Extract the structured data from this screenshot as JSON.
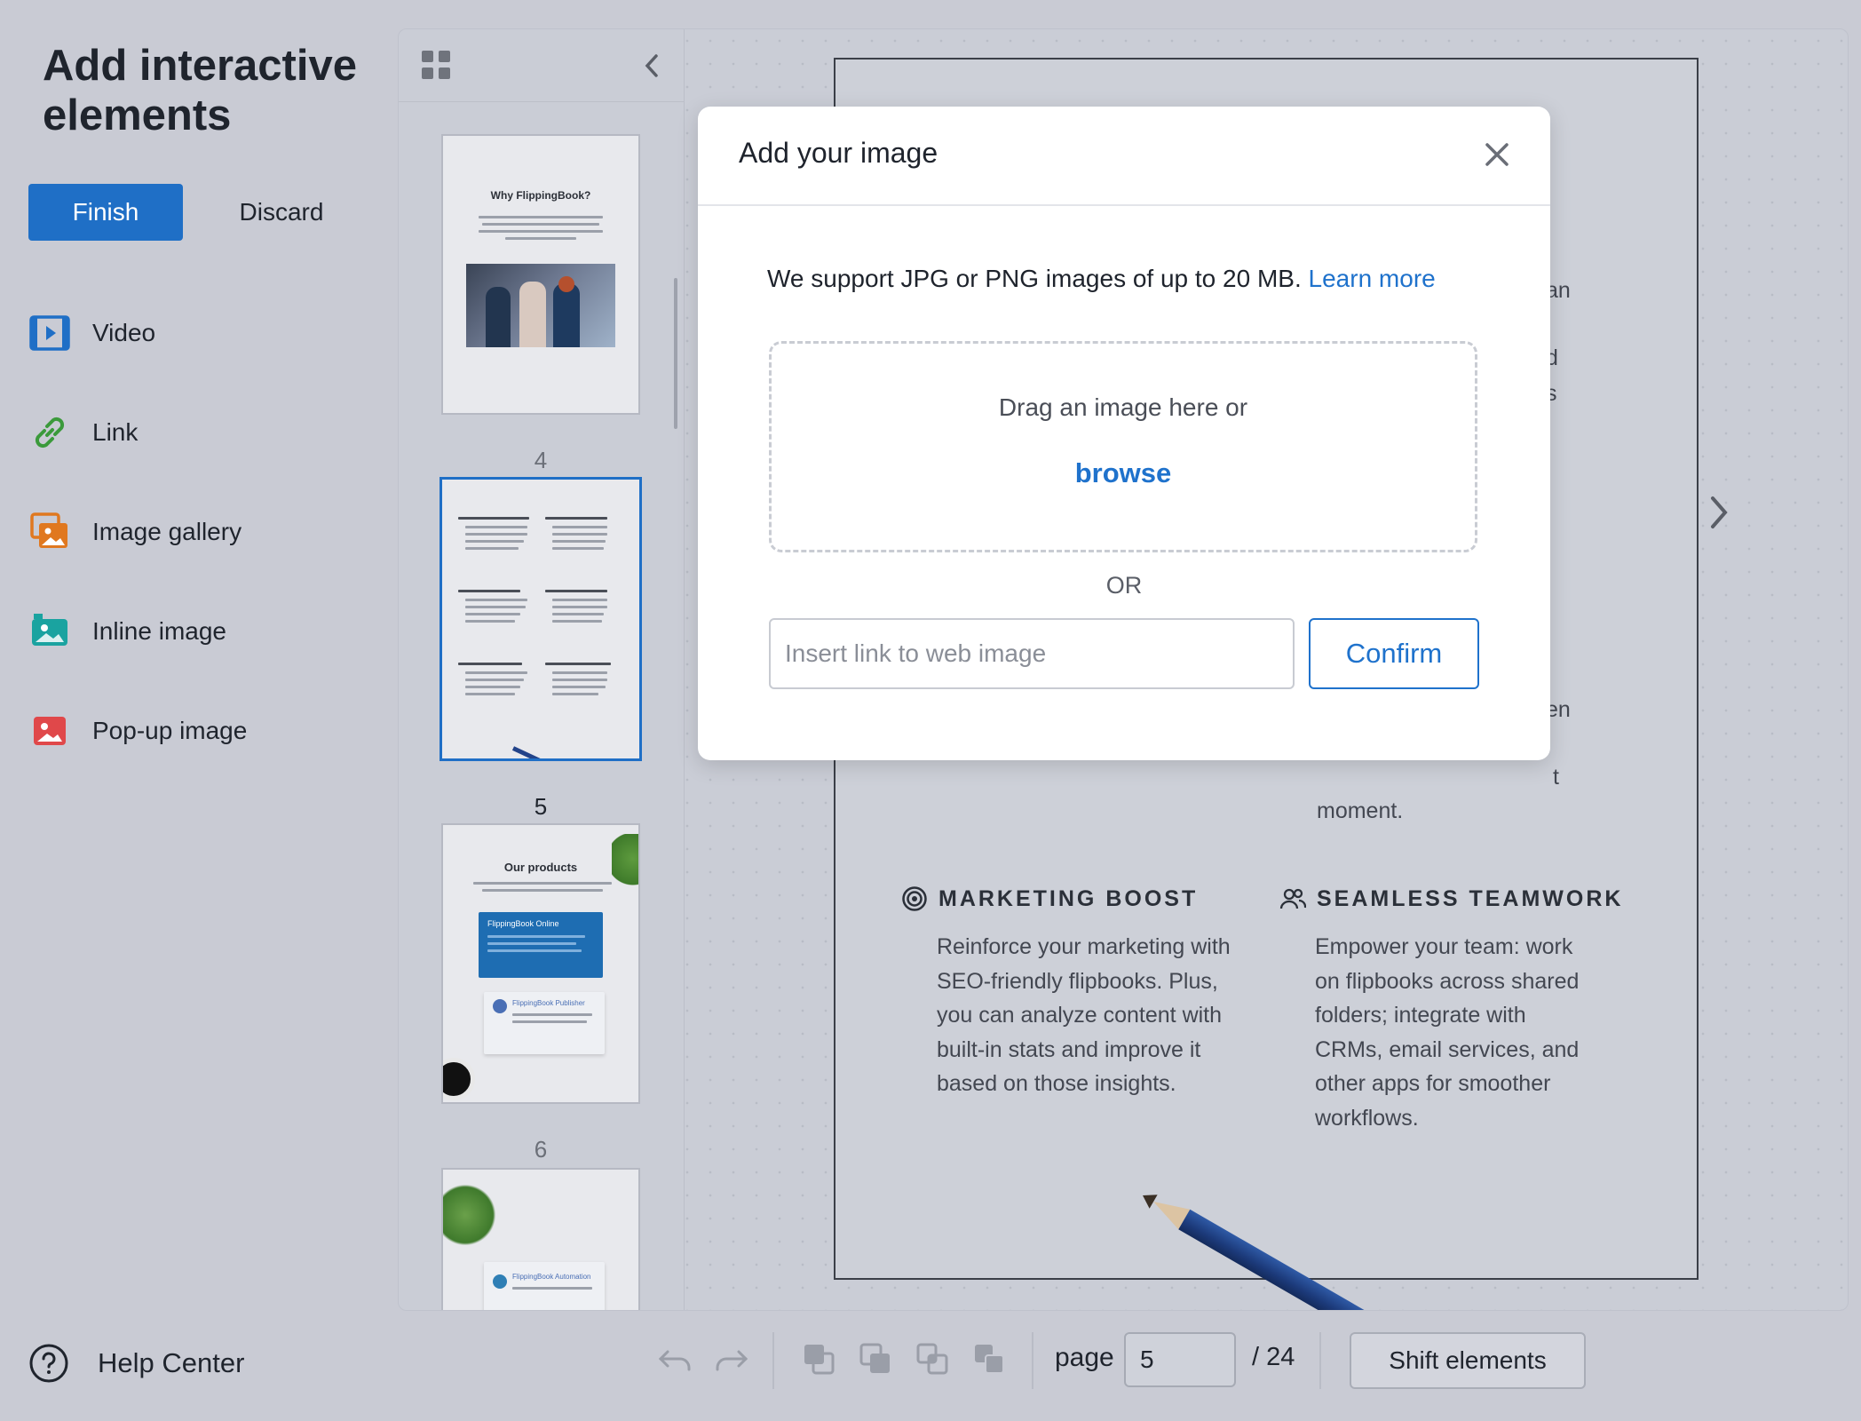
{
  "sidebar": {
    "title": "Add interactive elements",
    "finish_label": "Finish",
    "discard_label": "Discard",
    "items": [
      {
        "label": "Video",
        "icon": "video-icon",
        "color": "#1f6fc6"
      },
      {
        "label": "Link",
        "icon": "link-icon",
        "color": "#3b9a3b"
      },
      {
        "label": "Image gallery",
        "icon": "image-gallery-icon",
        "color": "#e0781f"
      },
      {
        "label": "Inline image",
        "icon": "inline-image-icon",
        "color": "#1aa3a0"
      },
      {
        "label": "Pop-up image",
        "icon": "popup-image-icon",
        "color": "#e0484a"
      }
    ],
    "help_label": "Help Center"
  },
  "thumbnails": [
    {
      "page": "4",
      "title": "Why FlippingBook?"
    },
    {
      "page": "5",
      "selected": true
    },
    {
      "page": "6",
      "title": "Our products",
      "card1": "FlippingBook Online",
      "card2": "FlippingBook Publisher"
    },
    {
      "card": "FlippingBook Automation"
    }
  ],
  "document": {
    "fragments": [
      "an",
      "d",
      "s",
      "en",
      "t",
      "moment."
    ],
    "sections": [
      {
        "heading": "MARKETING BOOST",
        "icon": "target-icon",
        "lines": [
          "Reinforce your marketing with",
          "SEO-friendly flipbooks. Plus,",
          "you can analyze content with",
          "built-in stats and improve it",
          "based on those insights."
        ]
      },
      {
        "heading": "SEAMLESS TEAMWORK",
        "icon": "team-icon",
        "lines": [
          "Empower your team: work",
          "on flipbooks across shared",
          "folders; integrate with",
          "CRMs, email services, and",
          "other apps for smoother",
          "workflows."
        ]
      }
    ]
  },
  "toolbar": {
    "page_label": "page",
    "page_value": "5",
    "page_total": "/ 24",
    "shift_label": "Shift elements"
  },
  "modal": {
    "title": "Add your image",
    "support_text": "We support JPG or PNG images of up to 20 MB.",
    "learn_more": "Learn more",
    "drag_text": "Drag an image here or",
    "browse": "browse",
    "or_text": "OR",
    "url_placeholder": "Insert link to web image",
    "confirm": "Confirm"
  },
  "colors": {
    "accent": "#1f6fc6",
    "link": "#1f72cc",
    "background": "#c9cbd4"
  }
}
